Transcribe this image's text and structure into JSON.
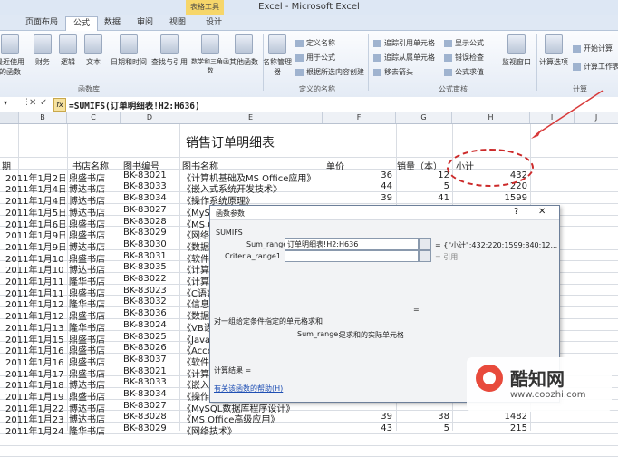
{
  "window": {
    "title": "Excel - Microsoft Excel",
    "context_tab": "表格工具"
  },
  "tabs": [
    "页面布局",
    "公式",
    "数据",
    "审阅",
    "视图",
    "设计"
  ],
  "ribbon": {
    "fn_buttons": [
      "最近使用的函数",
      "财务",
      "逻辑",
      "文本",
      "日期和时间",
      "查找与引用",
      "数学和三角函数",
      "其他函数"
    ],
    "names_button": "名称管理器",
    "defined_names": [
      "定义名称",
      "用于公式",
      "根据所选内容创建"
    ],
    "audit": [
      "追踪引用单元格",
      "追踪从属单元格",
      "移去箭头",
      "显示公式",
      "错误检查",
      "公式求值"
    ],
    "watch": "监视窗口",
    "calc_options": "计算选项",
    "calc_small": [
      "开始计算",
      "计算工作表"
    ],
    "groups": [
      "函数库",
      "定义的名称",
      "公式审核",
      "计算"
    ]
  },
  "formula_bar": {
    "fx": "fx",
    "formula": "=SUMIFS(订单明细表!H2:H636)"
  },
  "columns": [
    "B",
    "C",
    "D",
    "E",
    "F",
    "G",
    "H",
    "I",
    "J"
  ],
  "sheet": {
    "title": "销售订单明细表",
    "headers": [
      "期",
      "书店名称",
      "图书编号",
      "图书名称",
      "单价",
      "销量（本）",
      "小计"
    ],
    "rows": [
      {
        "date": "2011年1月2日",
        "store": "鼎盛书店",
        "code": "BK-83021",
        "name": "《计算机基础及MS Office应用》",
        "price": "36",
        "qty": "12",
        "sub": "432"
      },
      {
        "date": "2011年1月4日",
        "store": "博达书店",
        "code": "BK-83033",
        "name": "《嵌入式系统开发技术》",
        "price": "44",
        "qty": "5",
        "sub": "220"
      },
      {
        "date": "2011年1月4日",
        "store": "博达书店",
        "code": "BK-83034",
        "name": "《操作系统原理》",
        "price": "39",
        "qty": "41",
        "sub": "1599"
      },
      {
        "date": "2011年1月5日",
        "store": "博达书店",
        "code": "BK-83027",
        "name": "《MySQL数据库程序设计》",
        "price": "",
        "qty": "",
        "sub": ""
      },
      {
        "date": "2011年1月6日",
        "store": "鼎盛书店",
        "code": "BK-83028",
        "name": "《MS O",
        "price": "",
        "qty": "",
        "sub": ""
      },
      {
        "date": "2011年1月9日",
        "store": "鼎盛书店",
        "code": "BK-83029",
        "name": "《网络",
        "price": "",
        "qty": "",
        "sub": ""
      },
      {
        "date": "2011年1月9日",
        "store": "博达书店",
        "code": "BK-83030",
        "name": "《数据",
        "price": "",
        "qty": "",
        "sub": ""
      },
      {
        "date": "2011年1月10日",
        "store": "鼎盛书店",
        "code": "BK-83031",
        "name": "《软件",
        "price": "",
        "qty": "",
        "sub": ""
      },
      {
        "date": "2011年1月10日",
        "store": "博达书店",
        "code": "BK-83035",
        "name": "《计算",
        "price": "",
        "qty": "",
        "sub": ""
      },
      {
        "date": "2011年1月11日",
        "store": "隆华书店",
        "code": "BK-83022",
        "name": "《计算",
        "price": "",
        "qty": "",
        "sub": ""
      },
      {
        "date": "2011年1月11日",
        "store": "鼎盛书店",
        "code": "BK-83023",
        "name": "《C语言",
        "price": "",
        "qty": "",
        "sub": ""
      },
      {
        "date": "2011年1月12日",
        "store": "隆华书店",
        "code": "BK-83032",
        "name": "《信息",
        "price": "",
        "qty": "",
        "sub": ""
      },
      {
        "date": "2011年1月12日",
        "store": "鼎盛书店",
        "code": "BK-83036",
        "name": "《数据",
        "price": "",
        "qty": "",
        "sub": ""
      },
      {
        "date": "2011年1月13日",
        "store": "隆华书店",
        "code": "BK-83024",
        "name": "《VB语",
        "price": "",
        "qty": "",
        "sub": ""
      },
      {
        "date": "2011年1月15日",
        "store": "鼎盛书店",
        "code": "BK-83025",
        "name": "《Java",
        "price": "",
        "qty": "",
        "sub": ""
      },
      {
        "date": "2011年1月16日",
        "store": "鼎盛书店",
        "code": "BK-83026",
        "name": "《Acce",
        "price": "",
        "qty": "",
        "sub": ""
      },
      {
        "date": "2011年1月16日",
        "store": "鼎盛书店",
        "code": "BK-83037",
        "name": "《软件",
        "price": "",
        "qty": "",
        "sub": ""
      },
      {
        "date": "2011年1月17日",
        "store": "鼎盛书店",
        "code": "BK-83021",
        "name": "《计算",
        "price": "",
        "qty": "",
        "sub": ""
      },
      {
        "date": "2011年1月18日",
        "store": "博达书店",
        "code": "BK-83033",
        "name": "《嵌入",
        "price": "",
        "qty": "",
        "sub": ""
      },
      {
        "date": "2011年1月19日",
        "store": "鼎盛书店",
        "code": "BK-83034",
        "name": "《操作",
        "price": "",
        "qty": "",
        "sub": ""
      },
      {
        "date": "2011年1月22日",
        "store": "博达书店",
        "code": "BK-83027",
        "name": "《MySQL数据库程序设计》",
        "price": "",
        "qty": "",
        "sub": ""
      },
      {
        "date": "2011年1月23日",
        "store": "博达书店",
        "code": "BK-83028",
        "name": "《MS Office高级应用》",
        "price": "39",
        "qty": "38",
        "sub": "1482"
      },
      {
        "date": "2011年1月24日",
        "store": "隆华书店",
        "code": "BK-83029",
        "name": "《网络技术》",
        "price": "43",
        "qty": "5",
        "sub": "215"
      }
    ]
  },
  "dialog": {
    "title": "函数参数",
    "help_glyph": "?",
    "close_glyph": "✕",
    "fn_name": "SUMIFS",
    "sum_range_label": "Sum_range",
    "sum_range_value": "订单明细表!H2:H636",
    "sum_range_result": "= {\"小计\";432;220;1599;840;12...",
    "criteria_label": "Criteria_range1",
    "criteria_result": "= 引用",
    "equals": "=",
    "desc": "对一组给定条件指定的单元格求和",
    "arg_desc_label": "Sum_range:",
    "arg_desc": "是求和的实际单元格",
    "result_label": "计算结果 =",
    "help_link": "有关该函数的帮助(H)"
  },
  "watermark": {
    "brand": "酷知网",
    "url": "www.coozhi.com"
  }
}
